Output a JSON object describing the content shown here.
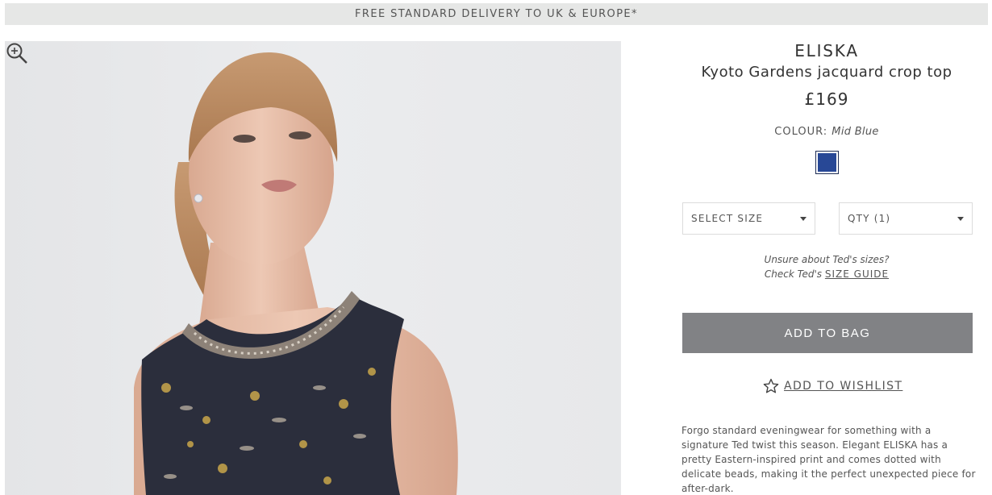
{
  "banner": {
    "text": "FREE STANDARD DELIVERY TO UK & EUROPE*"
  },
  "gallery": {
    "image_icon": "zoom-in-icon"
  },
  "product": {
    "brand": "ELISKA",
    "name": "Kyoto Gardens jacquard crop top",
    "price": "£169",
    "colour_label": "COLOUR:",
    "colour_value": "Mid Blue",
    "swatch_color": "#284896"
  },
  "selectors": {
    "size_label": "SELECT SIZE",
    "qty_label": "QTY (1)"
  },
  "size_help": {
    "line1": "Unsure about Ted's sizes?",
    "line2_prefix": "Check Ted's",
    "guide_link": "SIZE GUIDE"
  },
  "actions": {
    "add_to_bag": "ADD TO BAG",
    "add_to_wishlist": "ADD TO WISHLIST",
    "wishlist_icon": "star-icon",
    "add_to_bag_color": "#818285"
  },
  "description": "Forgo standard eveningwear for something with a signature Ted twist this season. Elegant ELISKA has a pretty Eastern-inspired print and comes dotted with delicate beads, making it the perfect unexpected piece for after-dark."
}
